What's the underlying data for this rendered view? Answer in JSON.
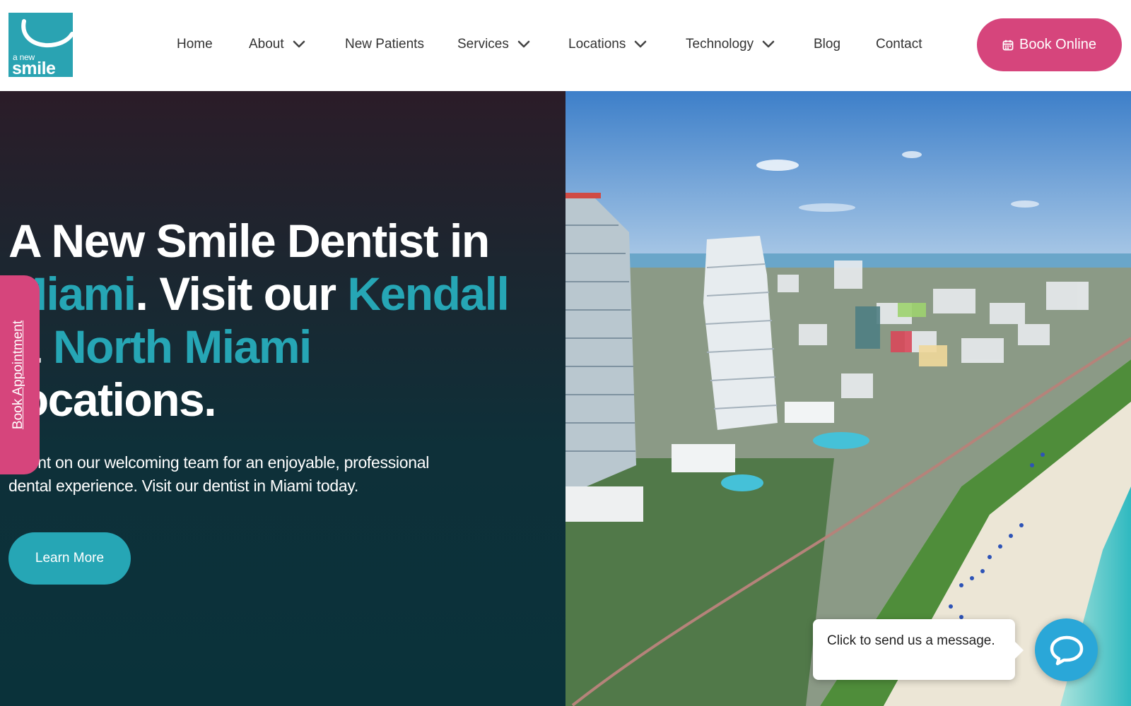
{
  "brand": {
    "logo_small": "a new",
    "logo_big": "smile",
    "logo_color": "#2aa3b2",
    "accent_pink": "#d6457c",
    "accent_teal": "#26a6b5"
  },
  "nav": {
    "items": [
      {
        "label": "Home",
        "has_dropdown": false
      },
      {
        "label": "About",
        "has_dropdown": true
      },
      {
        "label": "New Patients",
        "has_dropdown": false
      },
      {
        "label": "Services",
        "has_dropdown": true
      },
      {
        "label": "Locations",
        "has_dropdown": true
      },
      {
        "label": "Technology",
        "has_dropdown": true
      },
      {
        "label": "Blog",
        "has_dropdown": false
      },
      {
        "label": "Contact",
        "has_dropdown": false
      }
    ],
    "dropdown_icon": "chevron-down-icon",
    "book_online_label": "Book Online",
    "book_online_icon": "calendar-icon"
  },
  "hero": {
    "headline": {
      "part1": "A New Smile Dentist in ",
      "part2": "Miami",
      "part3": ". Visit our ",
      "part4": "Kendall",
      "part5": " & ",
      "part6": "North Miami",
      "part7": " locations."
    },
    "subtext": "Count on our welcoming team for an enjoyable, professional dental experience. Visit our dentist in Miami today.",
    "cta_label": "Learn More",
    "image_description_icon": "miami-beach-aerial-image"
  },
  "side_tab": {
    "label": "Book Appointment"
  },
  "chat": {
    "prompt": "Click to send us a message.",
    "icon": "chat-bubble-icon"
  }
}
